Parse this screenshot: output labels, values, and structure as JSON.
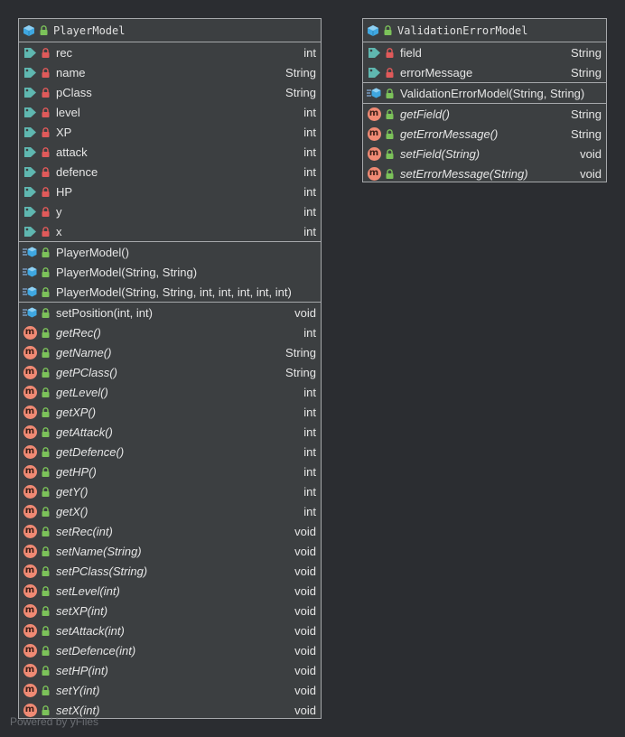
{
  "classes": [
    {
      "name": "PlayerModel",
      "fields": [
        {
          "name": "rec",
          "type": "int"
        },
        {
          "name": "name",
          "type": "String"
        },
        {
          "name": "pClass",
          "type": "String"
        },
        {
          "name": "level",
          "type": "int"
        },
        {
          "name": "XP",
          "type": "int"
        },
        {
          "name": "attack",
          "type": "int"
        },
        {
          "name": "defence",
          "type": "int"
        },
        {
          "name": "HP",
          "type": "int"
        },
        {
          "name": "y",
          "type": "int"
        },
        {
          "name": "x",
          "type": "int"
        }
      ],
      "constructors": [
        {
          "name": "PlayerModel()",
          "type": ""
        },
        {
          "name": "PlayerModel(String, String)",
          "type": ""
        },
        {
          "name": "PlayerModel(String, String, int, int, int, int, int)",
          "type": ""
        }
      ],
      "methods": [
        {
          "name": "setPosition(int, int)",
          "type": "void",
          "kind": "instance",
          "italic": false
        },
        {
          "name": "getRec()",
          "type": "int",
          "kind": "m",
          "italic": true
        },
        {
          "name": "getName()",
          "type": "String",
          "kind": "m",
          "italic": true
        },
        {
          "name": "getPClass()",
          "type": "String",
          "kind": "m",
          "italic": true
        },
        {
          "name": "getLevel()",
          "type": "int",
          "kind": "m",
          "italic": true
        },
        {
          "name": "getXP()",
          "type": "int",
          "kind": "m",
          "italic": true
        },
        {
          "name": "getAttack()",
          "type": "int",
          "kind": "m",
          "italic": true
        },
        {
          "name": "getDefence()",
          "type": "int",
          "kind": "m",
          "italic": true
        },
        {
          "name": "getHP()",
          "type": "int",
          "kind": "m",
          "italic": true
        },
        {
          "name": "getY()",
          "type": "int",
          "kind": "m",
          "italic": true
        },
        {
          "name": "getX()",
          "type": "int",
          "kind": "m",
          "italic": true
        },
        {
          "name": "setRec(int)",
          "type": "void",
          "kind": "m",
          "italic": true
        },
        {
          "name": "setName(String)",
          "type": "void",
          "kind": "m",
          "italic": true
        },
        {
          "name": "setPClass(String)",
          "type": "void",
          "kind": "m",
          "italic": true
        },
        {
          "name": "setLevel(int)",
          "type": "void",
          "kind": "m",
          "italic": true
        },
        {
          "name": "setXP(int)",
          "type": "void",
          "kind": "m",
          "italic": true
        },
        {
          "name": "setAttack(int)",
          "type": "void",
          "kind": "m",
          "italic": true
        },
        {
          "name": "setDefence(int)",
          "type": "void",
          "kind": "m",
          "italic": true
        },
        {
          "name": "setHP(int)",
          "type": "void",
          "kind": "m",
          "italic": true
        },
        {
          "name": "setY(int)",
          "type": "void",
          "kind": "m",
          "italic": true
        },
        {
          "name": "setX(int)",
          "type": "void",
          "kind": "m",
          "italic": true
        }
      ]
    },
    {
      "name": "ValidationErrorModel",
      "fields": [
        {
          "name": "field",
          "type": "String"
        },
        {
          "name": "errorMessage",
          "type": "String"
        }
      ],
      "constructors": [
        {
          "name": "ValidationErrorModel(String, String)",
          "type": ""
        }
      ],
      "methods": [
        {
          "name": "getField()",
          "type": "String",
          "kind": "m",
          "italic": true
        },
        {
          "name": "getErrorMessage()",
          "type": "String",
          "kind": "m",
          "italic": true
        },
        {
          "name": "setField(String)",
          "type": "void",
          "kind": "m",
          "italic": true
        },
        {
          "name": "setErrorMessage(String)",
          "type": "void",
          "kind": "m",
          "italic": true
        }
      ]
    }
  ],
  "watermark": "Powered by yFiles",
  "colors": {
    "background": "#2b2d31",
    "node_fill": "#3c3f41",
    "node_border": "#a6a8ab",
    "class_icon": "#3fa7e0",
    "field_icon": "#5fb7b0",
    "private_lock": "#e05a5a",
    "public_lock": "#7cc25a",
    "method_badge": "#f08a74"
  }
}
